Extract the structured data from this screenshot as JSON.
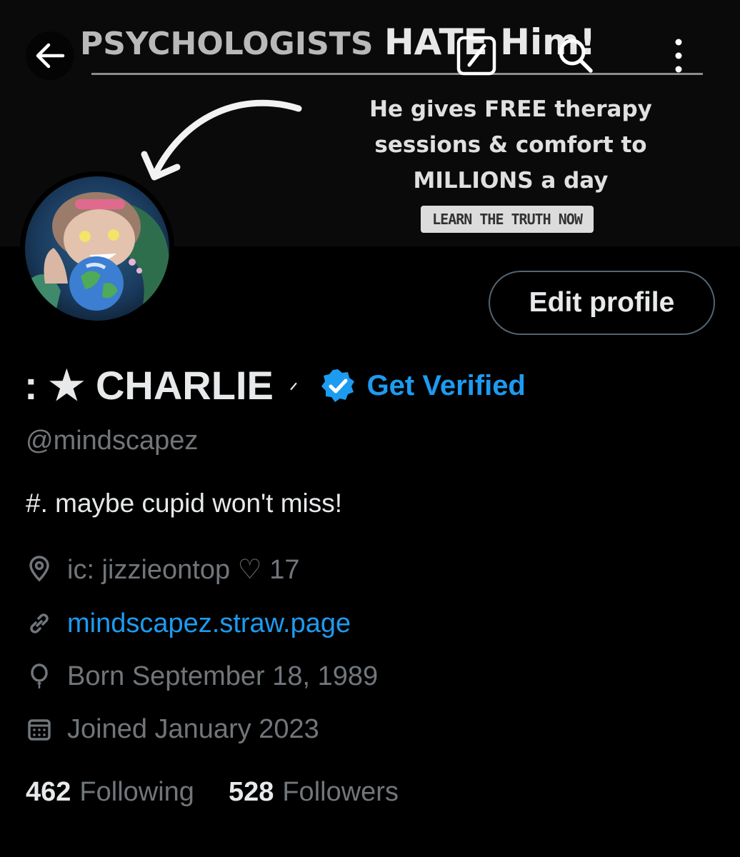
{
  "banner": {
    "headline_a": "PSYCHOLOGISTS ",
    "headline_b": "HATE Him!",
    "line1": "He gives FREE therapy",
    "line2": "sessions & comfort to",
    "line3": "MILLIONS a day",
    "cta": "LEARN THE TRUTH NOW"
  },
  "topbar": {
    "icons": [
      "back-arrow-icon",
      "grok-icon",
      "search-icon",
      "more-vertical-icon"
    ]
  },
  "profile": {
    "display_name": ": ★ CHARLIE",
    "name_tail": "ᐟ",
    "verify_label": "Get Verified",
    "handle": "@mindscapez",
    "bio": "#. maybe cupid won't miss!",
    "location": "ic: jizzieontop ♡ 17",
    "website": "mindscapez.straw.page",
    "birthday": "Born September 18, 1989",
    "joined": "Joined January 2023",
    "edit_label": "Edit profile"
  },
  "stats": {
    "following_count": "462",
    "following_label": "Following",
    "followers_count": "528",
    "followers_label": "Followers"
  },
  "colors": {
    "background": "#000000",
    "accent": "#1d9bf0",
    "secondary_text": "#71767b",
    "primary_text": "#e7e9ea",
    "border": "#536471"
  }
}
